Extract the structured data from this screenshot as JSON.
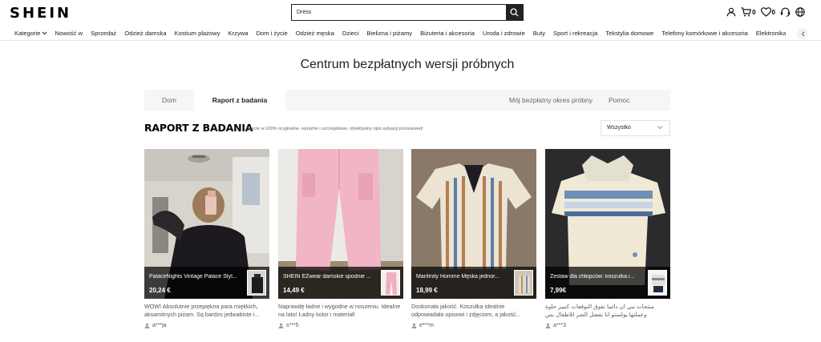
{
  "header": {
    "logo": "SHEIN",
    "search_value": "Dress",
    "cart_count": "0",
    "wishlist_count": "0"
  },
  "nav": {
    "items": [
      {
        "label": "Kategorie"
      },
      {
        "label": "Nowość w"
      },
      {
        "label": "Sprzedaż"
      },
      {
        "label": "Odzież damska"
      },
      {
        "label": "Kostium plażowy"
      },
      {
        "label": "Krzywa"
      },
      {
        "label": "Dom i życie"
      },
      {
        "label": "Odzież męska"
      },
      {
        "label": "Dzieci"
      },
      {
        "label": "Bielizna i piżamy"
      },
      {
        "label": "Biżuteria i akcesoria"
      },
      {
        "label": "Uroda i zdrowie"
      },
      {
        "label": "Buty"
      },
      {
        "label": "Sport i rekreacja"
      },
      {
        "label": "Tekstylia domowe"
      },
      {
        "label": "Telefony komórkowe i akcesoria"
      },
      {
        "label": "Elektronika"
      }
    ]
  },
  "page": {
    "title": "Centrum bezpłatnych wersji próbnych",
    "tabs": [
      {
        "label": "Dom"
      },
      {
        "label": "Raport z badania"
      },
      {
        "label": "Mój bezpłatny okres próbny"
      },
      {
        "label": "Pomoc"
      }
    ],
    "report_heading": "RAPORT Z BADANIA",
    "report_sub": "Zdjęcie w 100% oryginalne, wyraźne i szczegółowe, obiektywny opis sytuacji procesowej!",
    "filter_selected": "Wszystko"
  },
  "cards": [
    {
      "name": "PalaceNights Vintage Palace Styl...",
      "price": "20,24 €",
      "text": "WOW! Absolutnie przepiękna para miękkich, aksamitnych piżam. Są bardzo jedwabiste i...",
      "user": "a***ja"
    },
    {
      "name": "SHEIN EZwear damskie spodnie ...",
      "price": "14,49 €",
      "text": "Naprawdę ładne i wygodne w noszeniu. Idealne na lato! Ładny kolor i materiał!",
      "user": "s***5"
    },
    {
      "name": "Manfinity Homme Męska jednor...",
      "price": "18,99 €",
      "text": "Doskonała jakość. Koszulka idealnie odpowiadała opisowi i zdjęciom, a jakość...",
      "user": "e***m"
    },
    {
      "name": "Zestaw dla chłopców: koszulka i...",
      "price": "7,99€",
      "text": "منتجات تبي ان دائما تفوق التوقعات كنيير حلوة وعملتها يولستو انا بفضل الشر للاطفال بس",
      "user": "a***3"
    }
  ],
  "colors": {
    "text": "#222222",
    "muted": "#666666",
    "tab_bg": "#f6f6f6",
    "overlay": "rgba(0,0,0,0.72)"
  }
}
